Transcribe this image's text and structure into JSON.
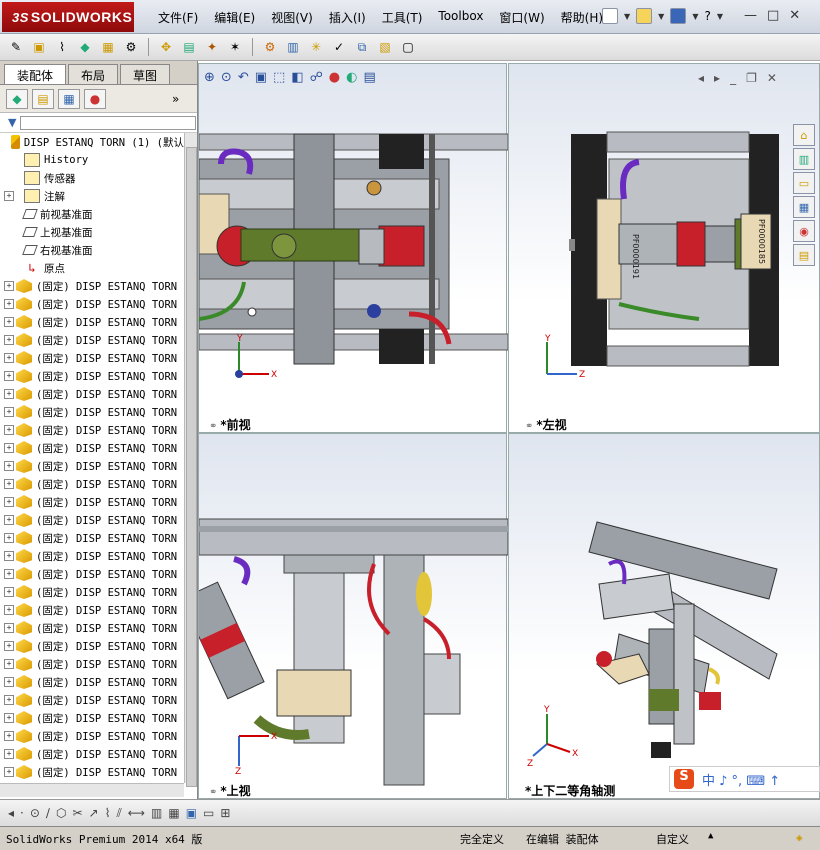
{
  "app": {
    "logo_prefix": "3S",
    "logo_text": "SOLIDWORKS"
  },
  "menu": [
    "文件(F)",
    "编辑(E)",
    "视图(V)",
    "插入(I)",
    "工具(T)",
    "Toolbox",
    "窗口(W)",
    "帮助(H)"
  ],
  "window_controls": {
    "minimize": "—",
    "restore": "□",
    "close": "✕"
  },
  "panel": {
    "tabs": [
      "装配体",
      "布局",
      "草图"
    ],
    "active_tab": "装配体"
  },
  "tree": {
    "root": "DISP ESTANQ TORN (1)  (默认",
    "fixed_items": [
      {
        "label": "History",
        "icon": "history-icon"
      },
      {
        "label": "传感器",
        "icon": "sensor-icon"
      },
      {
        "label": "注解",
        "icon": "annotation-icon"
      },
      {
        "label": "前视基准面",
        "icon": "plane-icon"
      },
      {
        "label": "上视基准面",
        "icon": "plane-icon"
      },
      {
        "label": "右视基准面",
        "icon": "plane-icon"
      },
      {
        "label": "原点",
        "icon": "origin-icon"
      }
    ],
    "component_label": "(固定) DISP ESTANQ TORN",
    "component_count": 28
  },
  "viewports": [
    {
      "name": "*前视",
      "axes": {
        "h": "X",
        "v": "Y"
      }
    },
    {
      "name": "*左视",
      "axes": {
        "h": "Z",
        "v": "Y"
      }
    },
    {
      "name": "*上视",
      "axes": {
        "h": "X",
        "v": "Z"
      }
    },
    {
      "name": "*上下二等角轴测",
      "axes": {
        "h": "X",
        "v": "Y",
        "d": "Z"
      }
    }
  ],
  "labels_in_model": {
    "front_plate": "PF0000185",
    "left_plate": "PF0000191"
  },
  "ime": {
    "s": "S",
    "text": "中 ♪ °, ⌨ ↑"
  },
  "status": {
    "product": "SolidWorks Premium 2014 x64 版",
    "definition": "完全定义",
    "mode": "在编辑 装配体",
    "units": "自定义"
  },
  "colors": {
    "accent": "#c21a1a",
    "frame": "#8c9198",
    "purple": "#6a2cc0",
    "red": "#c8202a",
    "green": "#5e7a2a",
    "cream": "#e9d8b4"
  }
}
